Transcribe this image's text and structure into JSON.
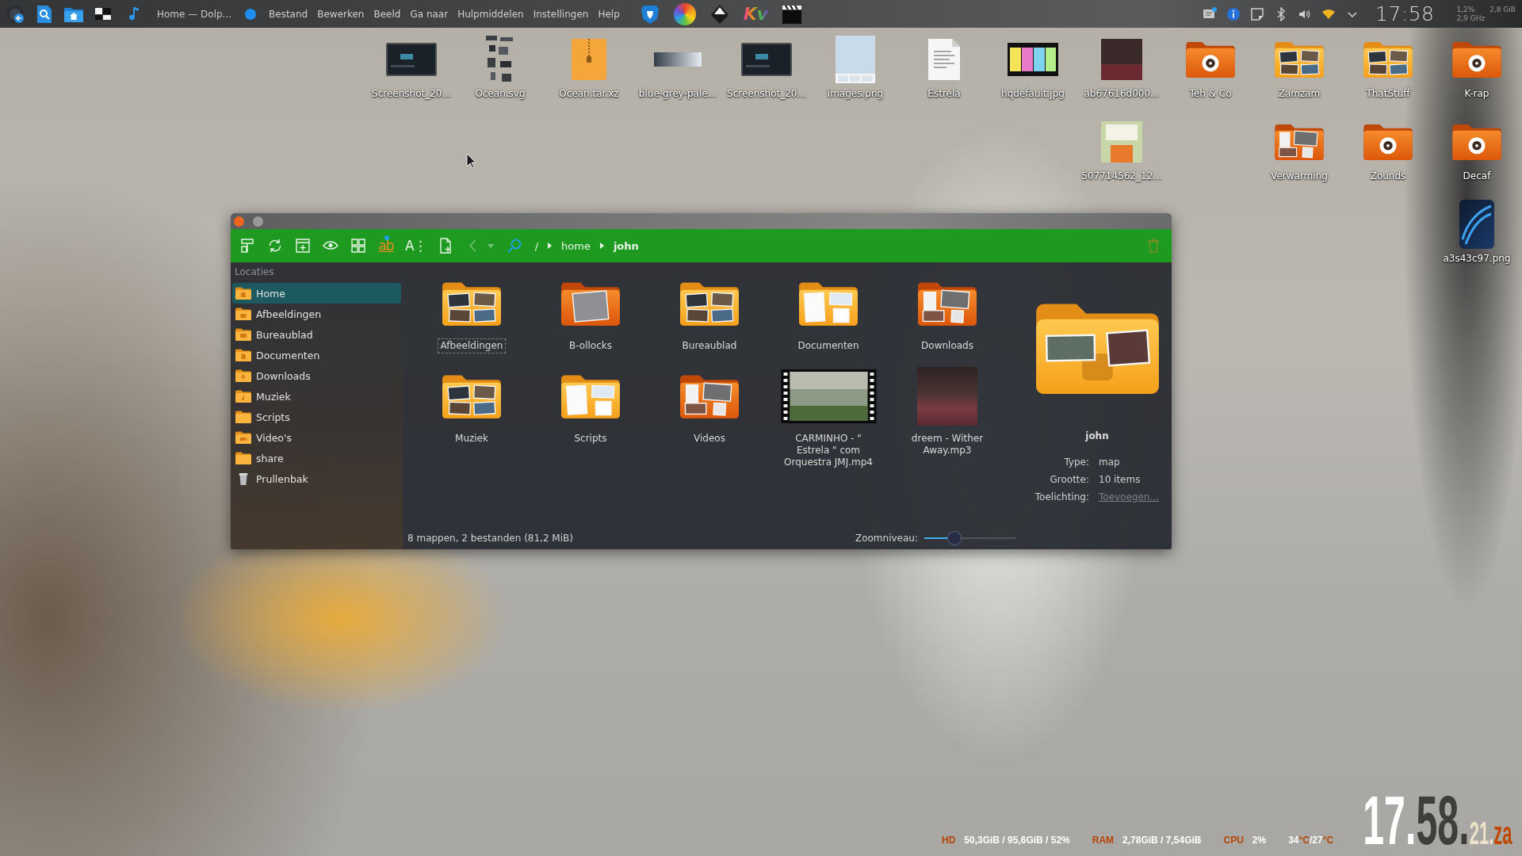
{
  "panel": {
    "window_title": "Home — Dolp...",
    "menu": [
      "Bestand",
      "Bewerken",
      "Beeld",
      "Ga naar",
      "Hulpmiddelen",
      "Instellingen",
      "Help"
    ],
    "app_badge": "Kv",
    "clock": "17:58",
    "monitor": [
      "1,2%",
      "2,8 GiB",
      "2,9 GHz"
    ]
  },
  "desktop_icons": [
    {
      "label": "Screenshot_20...",
      "kind": "screenshot"
    },
    {
      "label": "Ocean.svg",
      "kind": "drawing"
    },
    {
      "label": "Ocean.tar.xz",
      "kind": "archive"
    },
    {
      "label": "blue-grey-pale...",
      "kind": "palette"
    },
    {
      "label": "Screenshot_20...",
      "kind": "screenshot"
    },
    {
      "label": "images.png",
      "kind": "swatch"
    },
    {
      "label": "Estrela",
      "kind": "document"
    },
    {
      "label": "hqdefault.jpg",
      "kind": "banner"
    },
    {
      "label": "ab67616d000...",
      "kind": "photo"
    },
    {
      "label": "Teh & Co",
      "kind": "emblem"
    },
    {
      "label": "Zamzam",
      "kind": "album"
    },
    {
      "label": "ThatStuff",
      "kind": "album"
    },
    {
      "label": "K-rap",
      "kind": "emblem"
    },
    {
      "label": "507714562_12...",
      "kind": "picture"
    },
    {
      "label": "Verwarming",
      "kind": "collage"
    },
    {
      "label": "Zounds",
      "kind": "emblem"
    },
    {
      "label": "Decaf",
      "kind": "emblem"
    },
    {
      "label": "a3s43c97.png",
      "kind": "phone"
    }
  ],
  "window": {
    "toolbar": [
      {
        "kind": "split",
        "disabled": false
      },
      {
        "kind": "reload",
        "disabled": false
      },
      {
        "kind": "newtab",
        "disabled": false
      },
      {
        "kind": "preview",
        "disabled": false
      },
      {
        "kind": "icons",
        "disabled": false
      },
      {
        "kind": "rename",
        "text": "ab",
        "disabled": false
      },
      {
        "kind": "font",
        "text": "A⋮",
        "disabled": false
      },
      {
        "kind": "newfile",
        "disabled": false
      },
      {
        "kind": "back",
        "disabled": true
      },
      {
        "kind": "history",
        "disabled": true
      },
      {
        "kind": "search",
        "disabled": false
      }
    ],
    "breadcrumbs": [
      {
        "label": "/",
        "selected": false
      },
      {
        "label": "home",
        "selected": false
      },
      {
        "label": "john",
        "selected": true
      }
    ],
    "toolbar_end": [
      {
        "kind": "trash",
        "disabled": true
      }
    ],
    "sidebar": {
      "heading": "Locaties",
      "items": [
        {
          "label": "Home",
          "kind": "home",
          "selected": true
        },
        {
          "label": "Afbeeldingen",
          "kind": "pictures",
          "selected": false
        },
        {
          "label": "Bureaublad",
          "kind": "desktop",
          "selected": false
        },
        {
          "label": "Documenten",
          "kind": "documents",
          "selected": false
        },
        {
          "label": "Downloads",
          "kind": "downloads",
          "selected": false
        },
        {
          "label": "Muziek",
          "kind": "music",
          "selected": false
        },
        {
          "label": "Scripts",
          "kind": "folder",
          "selected": false
        },
        {
          "label": "Video's",
          "kind": "videos",
          "selected": false
        },
        {
          "label": "share",
          "kind": "folder",
          "selected": false
        },
        {
          "label": "Prullenbak",
          "kind": "trash",
          "selected": false
        }
      ]
    },
    "items": [
      {
        "label": "Afbeeldingen",
        "kind": "album",
        "focused": true
      },
      {
        "label": "B-ollocks",
        "kind": "portrait",
        "focused": false
      },
      {
        "label": "Bureaublad",
        "kind": "album",
        "focused": false
      },
      {
        "label": "Documenten",
        "kind": "papers",
        "focused": false
      },
      {
        "label": "Downloads",
        "kind": "collage",
        "focused": false
      },
      {
        "label": "Muziek",
        "kind": "album",
        "focused": false
      },
      {
        "label": "Scripts",
        "kind": "papers",
        "focused": false
      },
      {
        "label": "Videos",
        "kind": "collage",
        "focused": false
      },
      {
        "label": "CARMINHO - \" Estrela \" com Orquestra JMJ.mp4",
        "kind": "video",
        "focused": false
      },
      {
        "label": "dreem - Wither Away.mp3",
        "kind": "cover",
        "focused": false
      }
    ],
    "info": {
      "name": "john",
      "properties": [
        {
          "label": "Type:",
          "value": "map",
          "kind": "text"
        },
        {
          "label": "Grootte:",
          "value": "10 items",
          "kind": "text"
        },
        {
          "label": "Toelichting:",
          "value": "Toevoegen...",
          "kind": "link"
        }
      ]
    },
    "status": {
      "summary": "8 mappen, 2 bestanden (81,2 MiB)",
      "zoom_label": "Zoomniveau:",
      "zoom": {
        "level": 0.33
      }
    }
  },
  "system_stats": [
    {
      "label": "HD",
      "value": "50,3GiB / 95,6GiB / 52%"
    },
    {
      "label": "RAM",
      "value": "2,78GiB / 7,54GiB"
    },
    {
      "label": "CPU",
      "value": "2%"
    }
  ],
  "temperature": [
    {
      "text": "34",
      "kind": "value"
    },
    {
      "text": "°C",
      "kind": "unit"
    },
    {
      "text": "/",
      "kind": "value"
    },
    {
      "text": "27",
      "kind": "value"
    },
    {
      "text": "°C",
      "kind": "unit"
    }
  ],
  "desktop_clock": [
    {
      "text": "17.",
      "kind": "hour"
    },
    {
      "text": "58.",
      "kind": "minute"
    },
    {
      "text": "21.",
      "kind": "second"
    },
    {
      "text": "za",
      "kind": "day"
    }
  ]
}
